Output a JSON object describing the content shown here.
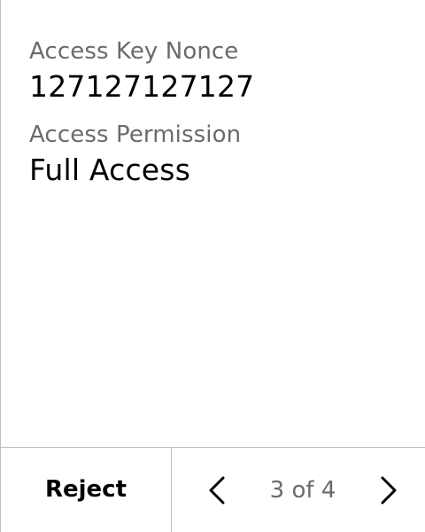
{
  "details": {
    "fields": [
      {
        "label": "Access Key Nonce",
        "value": "127127127127"
      },
      {
        "label": "Access Permission",
        "value": "Full Access"
      }
    ]
  },
  "footer": {
    "reject_label": "Reject",
    "page_indicator": "3 of 4",
    "prev_icon": "chevron-left-icon",
    "next_icon": "chevron-right-icon"
  },
  "colors": {
    "label": "#6b6b6b",
    "value": "#000000",
    "divider": "#bdbdbd",
    "background": "#ffffff"
  }
}
